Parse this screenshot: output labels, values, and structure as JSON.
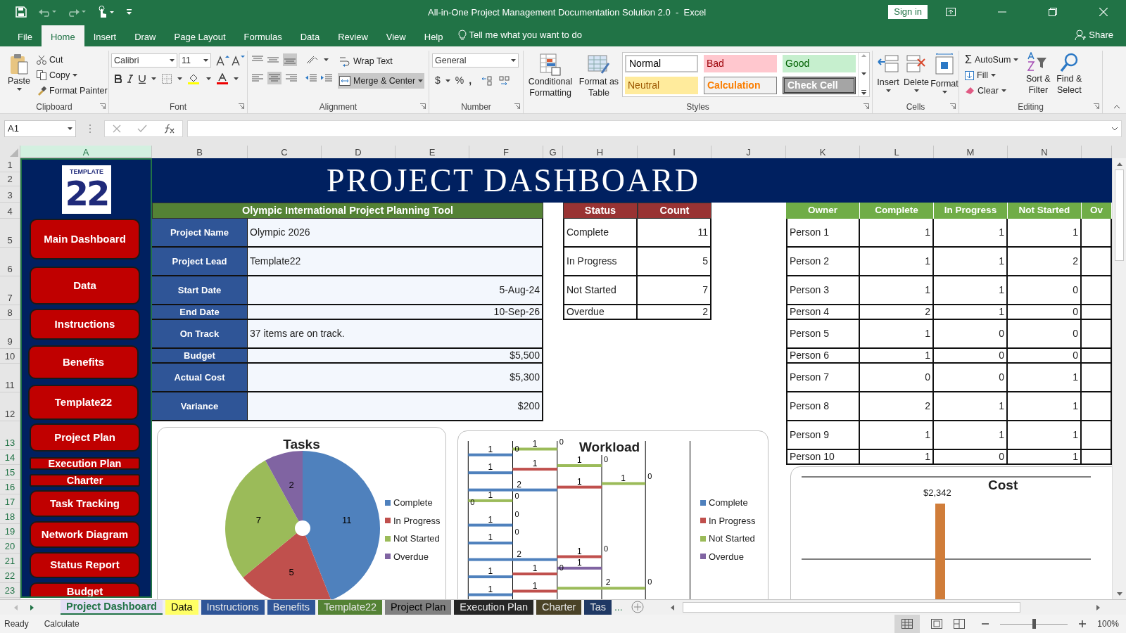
{
  "window": {
    "title": "All-in-One Project Management Documentation Solution 2.0  -  Excel",
    "sign_in": "Sign in",
    "share": "Share"
  },
  "ribbon_tabs": [
    {
      "label": "File",
      "selected": false
    },
    {
      "label": "Home",
      "selected": true
    },
    {
      "label": "Insert",
      "selected": false
    },
    {
      "label": "Draw",
      "selected": false
    },
    {
      "label": "Page Layout",
      "selected": false
    },
    {
      "label": "Formulas",
      "selected": false
    },
    {
      "label": "Data",
      "selected": false
    },
    {
      "label": "Review",
      "selected": false
    },
    {
      "label": "View",
      "selected": false
    },
    {
      "label": "Help",
      "selected": false
    }
  ],
  "tell_me": "Tell me what you want to do",
  "ribbon": {
    "clipboard": {
      "label": "Clipboard",
      "paste": "Paste",
      "cut": "Cut",
      "copy": "Copy",
      "format_painter": "Format Painter"
    },
    "font": {
      "label": "Font",
      "name": "Calibri",
      "size": "11"
    },
    "alignment": {
      "label": "Alignment",
      "wrap": "Wrap Text",
      "merge": "Merge & Center"
    },
    "number": {
      "label": "Number",
      "format": "General",
      "currency": "$",
      "percent": "%",
      "comma": ","
    },
    "styles": {
      "label": "Styles",
      "conditional": "Conditional Formatting",
      "format_table": "Format as Table",
      "gallery": [
        {
          "label": "Normal",
          "kind": "normal"
        },
        {
          "label": "Bad",
          "kind": "bad"
        },
        {
          "label": "Good",
          "kind": "good"
        },
        {
          "label": "Neutral",
          "kind": "neutral"
        },
        {
          "label": "Calculation",
          "kind": "calculation"
        },
        {
          "label": "Check Cell",
          "kind": "check"
        }
      ]
    },
    "cells": {
      "label": "Cells",
      "buttons": [
        "Insert",
        "Delete",
        "Format"
      ]
    },
    "editing": {
      "label": "Editing",
      "autosum_icon": "Σ",
      "autosum": "AutoSum",
      "fill": "Fill",
      "clear": "Clear",
      "sort": "Sort & Filter",
      "find": "Find & Select"
    }
  },
  "name_box": "A1",
  "columns": [
    "A",
    "B",
    "C",
    "D",
    "E",
    "F",
    "G",
    "H",
    "I",
    "J",
    "K",
    "L",
    "M",
    "N"
  ],
  "rows": [
    "1",
    "2",
    "3",
    "4",
    "5",
    "6",
    "7",
    "8",
    "9",
    "10",
    "11",
    "12",
    "13",
    "14",
    "15",
    "16",
    "17",
    "18",
    "19",
    "20",
    "21",
    "22",
    "23"
  ],
  "logo": {
    "number": "22",
    "word": "TEMPLATE"
  },
  "nav_buttons": [
    "Main Dashboard",
    "Data",
    "Instructions",
    "Benefits",
    "Template22",
    "Project Plan",
    "Execution Plan",
    "Charter",
    "Task Tracking",
    "Network Diagram",
    "Status Report",
    "Budget"
  ],
  "banner": "PROJECT DASHBOARD",
  "project_info": {
    "title": "Olympic International Project Planning Tool",
    "rows": [
      {
        "label": "Project Name",
        "value": "Olympic 2026",
        "kind": "text"
      },
      {
        "label": "Project Lead",
        "value": "Template22",
        "kind": "text"
      },
      {
        "label": "Start Date",
        "value": "5-Aug-24",
        "kind": "number"
      },
      {
        "label": "End Date",
        "value": "10-Sep-26",
        "kind": "number"
      },
      {
        "label": "On Track",
        "value": "37 items are on track.",
        "kind": "text"
      },
      {
        "label": "Budget",
        "value": "$5,500",
        "kind": "number"
      },
      {
        "label": "Actual Cost",
        "value": "$5,300",
        "kind": "number"
      },
      {
        "label": "Variance",
        "value": "$200",
        "kind": "number"
      }
    ]
  },
  "status_table": {
    "columns": [
      "Status",
      "Count"
    ],
    "rows": [
      [
        "Complete",
        "11"
      ],
      [
        "In Progress",
        "5"
      ],
      [
        "Not Started",
        "7"
      ],
      [
        "Overdue",
        "2"
      ]
    ]
  },
  "owner_table": {
    "columns": [
      "Owner",
      "Complete",
      "In Progress",
      "Not Started",
      "Ov"
    ],
    "rows": [
      [
        "Person 1",
        "1",
        "1",
        "1"
      ],
      [
        "Person 2",
        "1",
        "1",
        "2"
      ],
      [
        "Person 3",
        "1",
        "1",
        "0"
      ],
      [
        "Person 4",
        "2",
        "1",
        "0"
      ],
      [
        "Person 5",
        "1",
        "0",
        "0"
      ],
      [
        "Person 6",
        "1",
        "0",
        "0"
      ],
      [
        "Person 7",
        "0",
        "0",
        "1"
      ],
      [
        "Person 8",
        "2",
        "1",
        "1"
      ],
      [
        "Person 9",
        "1",
        "1",
        "1"
      ],
      [
        "Person 10",
        "1",
        "0",
        "1"
      ]
    ]
  },
  "tasks_chart": {
    "chart_data": {
      "type": "pie",
      "title": "Tasks",
      "categories": [
        "Complete",
        "In Progress",
        "Not Started",
        "Overdue"
      ],
      "values": [
        11,
        5,
        7,
        2
      ],
      "colors": [
        "#4f81bd",
        "#c0504d",
        "#9bbb59",
        "#8064a2"
      ],
      "data_labels": true,
      "legend": "right"
    }
  },
  "workload_chart": {
    "title": "Workload",
    "legend": [
      {
        "name": "Complete",
        "color": "#4f81bd"
      },
      {
        "name": "In Progress",
        "color": "#c0504d"
      },
      {
        "name": "Not Started",
        "color": "#9bbb59"
      },
      {
        "name": "Overdue",
        "color": "#8064a2"
      }
    ],
    "bars": [
      {
        "color": "#4f81bd",
        "label": "1"
      },
      {
        "color": "#9bbb59",
        "label": "1"
      },
      {
        "color": "#4f81bd",
        "label": "1"
      },
      {
        "color": "#c0504d",
        "label": "1"
      },
      {
        "color": "#9bbb59",
        "label": "1"
      },
      {
        "color": "#4f81bd",
        "label": "2"
      },
      {
        "color": "#c0504d",
        "label": "1"
      },
      {
        "color": "#9bbb59",
        "label": "1"
      },
      {
        "color": "#9bbb59",
        "label": "1"
      },
      {
        "color": "#4f81bd",
        "label": "1"
      },
      {
        "color": "#4f81bd",
        "label": "1"
      },
      {
        "color": "#4f81bd",
        "label": "2"
      },
      {
        "color": "#c0504d",
        "label": "1"
      },
      {
        "color": "#8064a2",
        "label": "1"
      },
      {
        "color": "#c0504d",
        "label": "1"
      },
      {
        "color": "#4f81bd",
        "label": "1"
      },
      {
        "color": "#9bbb59",
        "label": "2"
      },
      {
        "color": "#c0504d",
        "label": "1"
      },
      {
        "color": "#4f81bd",
        "label": "1"
      }
    ],
    "zero_labels": [
      "0",
      "0",
      "0",
      "0",
      "0",
      "0",
      "0",
      "0",
      "0",
      "0",
      "0"
    ]
  },
  "cost_chart": {
    "title": "Cost",
    "value_label": "$2,342"
  },
  "sheet_tabs": [
    {
      "label": "Project Dashboard",
      "selected": true,
      "color": "#e4dff5"
    },
    {
      "label": "Data",
      "selected": false,
      "color": "#ffff66"
    },
    {
      "label": "Instructions",
      "selected": false,
      "color": "#2f5597"
    },
    {
      "label": "Benefits",
      "selected": false,
      "color": "#2f5597"
    },
    {
      "label": "Template22",
      "selected": false,
      "color": "#548235"
    },
    {
      "label": "Project Plan",
      "selected": false,
      "color": "#808080"
    },
    {
      "label": "Execution Plan",
      "selected": false,
      "color": "#262626"
    },
    {
      "label": "Charter",
      "selected": false,
      "color": "#4a4227"
    },
    {
      "label": "Tas",
      "selected": false,
      "color": "#1f3864"
    }
  ],
  "sheet_tabs_more": "...",
  "status_bar": {
    "items": [
      "Ready",
      "Calculate"
    ],
    "zoom": "100%"
  }
}
